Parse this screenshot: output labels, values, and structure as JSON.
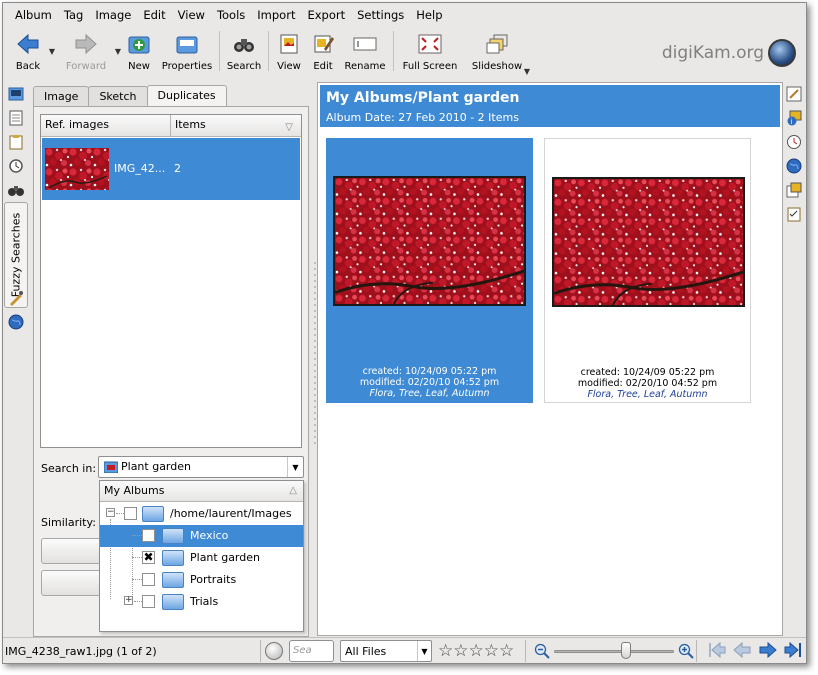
{
  "menubar": {
    "items": [
      "Album",
      "Tag",
      "Image",
      "Edit",
      "View",
      "Tools",
      "Import",
      "Export",
      "Settings",
      "Help"
    ]
  },
  "toolbar": {
    "back": "Back",
    "forward": "Forward",
    "new": "New",
    "properties": "Properties",
    "search": "Search",
    "view": "View",
    "edit": "Edit",
    "rename": "Rename",
    "full_screen": "Full Screen",
    "slideshow": "Slideshow",
    "brand": "digiKam.org"
  },
  "left_sidebar": {
    "fuzzy_searches": "Fuzzy Searches"
  },
  "left_panel": {
    "tabs": [
      "Image",
      "Sketch",
      "Duplicates"
    ],
    "active_tab": "Duplicates",
    "ref_list": {
      "col_ref_images": "Ref. images",
      "col_items": "Items",
      "row_name": "IMG_42...",
      "row_count": "2"
    },
    "search_in_label": "Search in:",
    "album_combo_value": "Plant garden",
    "similarity_label": "Similarity:",
    "dropdown": {
      "header": "My Albums",
      "root": "/home/laurent/Images",
      "items": [
        {
          "label": "Mexico",
          "checked": false,
          "selected": true
        },
        {
          "label": "Plant garden",
          "checked": true,
          "selected": false
        },
        {
          "label": "Portraits",
          "checked": false,
          "selected": false
        },
        {
          "label": "Trials",
          "checked": false,
          "selected": false
        }
      ]
    }
  },
  "main": {
    "album_title": "My Albums/Plant garden",
    "album_subtitle": "Album Date: 27 Feb 2010 - 2 Items",
    "thumbs": [
      {
        "created": "created: 10/24/09 05:22 pm",
        "modified": "modified: 02/20/10 04:52 pm",
        "tags": "Flora, Tree, Leaf, Autumn"
      },
      {
        "created": "created: 10/24/09 05:22 pm",
        "modified": "modified: 02/20/10 04:52 pm",
        "tags": "Flora, Tree, Leaf, Autumn"
      }
    ]
  },
  "statusbar": {
    "text": "IMG_4238_raw1.jpg (1 of 2)",
    "search_placeholder": "Sea",
    "filter_value": "All Files",
    "rating_stars": 0,
    "zoom_level": 0.6
  },
  "colors": {
    "selection": "#3f8ad5",
    "window_bg": "#e9e8e6",
    "tag_link": "#1d3f99"
  }
}
